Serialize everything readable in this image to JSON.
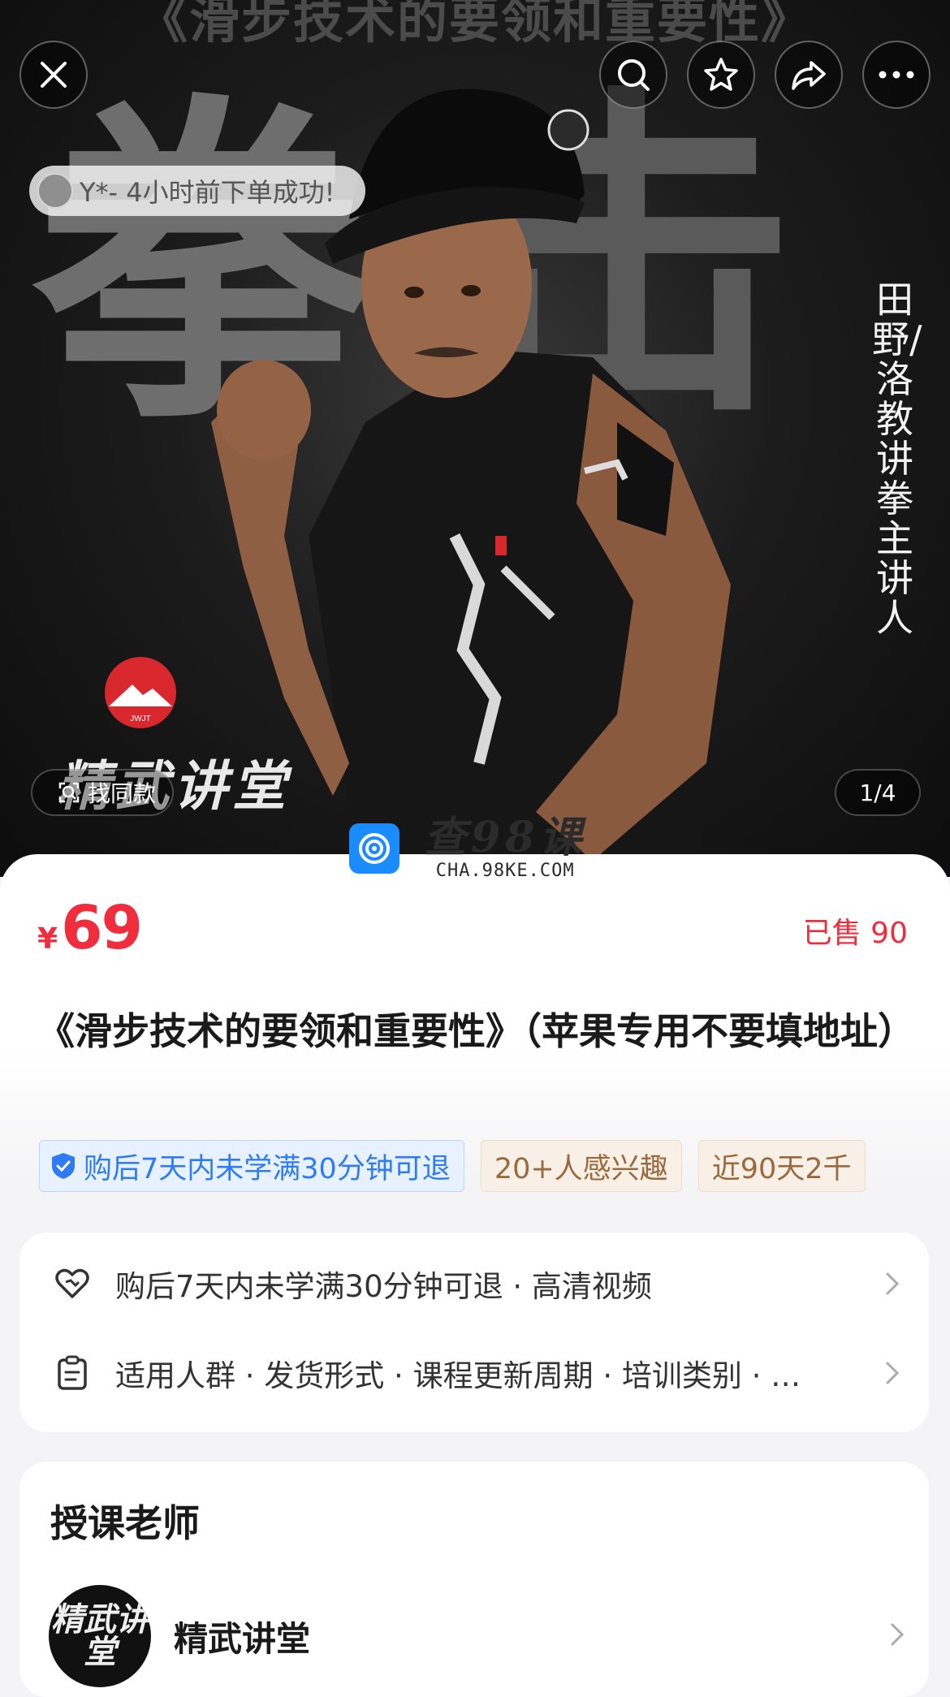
{
  "hero": {
    "banner_title": "《滑步技术的要领和重要性》",
    "bg_chars": [
      "拳",
      "击"
    ],
    "vertical_caption": "田野/洛教讲拳主讲人",
    "brand_logo_text": "精武讲堂",
    "brand_logo_badge": "JWJT",
    "notice": "Y*- 4小时前下单成功!",
    "find_similar": "找同款",
    "page_indicator": "1/4"
  },
  "toolbar": {
    "close_icon": "close-icon",
    "search_icon": "search-icon",
    "favorite_icon": "star-icon",
    "share_icon": "share-icon",
    "more_icon": "more-icon"
  },
  "watermark": {
    "text": "查98课",
    "url": "CHA.98KE.COM"
  },
  "product": {
    "currency": "¥",
    "price": "69",
    "sold": "已售 90",
    "title": "《滑步技术的要领和重要性》（苹果专用不要填地址）",
    "tags": [
      "购后7天内未学满30分钟可退",
      "20+人感兴趣",
      "近90天2千"
    ]
  },
  "features": {
    "row1": "购后7天内未学满30分钟可退 · 高清视频",
    "row2": "适用人群 · 发货形式 · 课程更新周期 · 培训类别 · …"
  },
  "teacher": {
    "section_title": "授课老师",
    "name": "精武讲堂",
    "avatar_text": "精武讲堂"
  },
  "colors": {
    "price": "#f02d3d",
    "tag_blue": "#2f7bf5",
    "tag_tan": "#9a6a3c",
    "watermark_blue": "#1a8cff"
  }
}
